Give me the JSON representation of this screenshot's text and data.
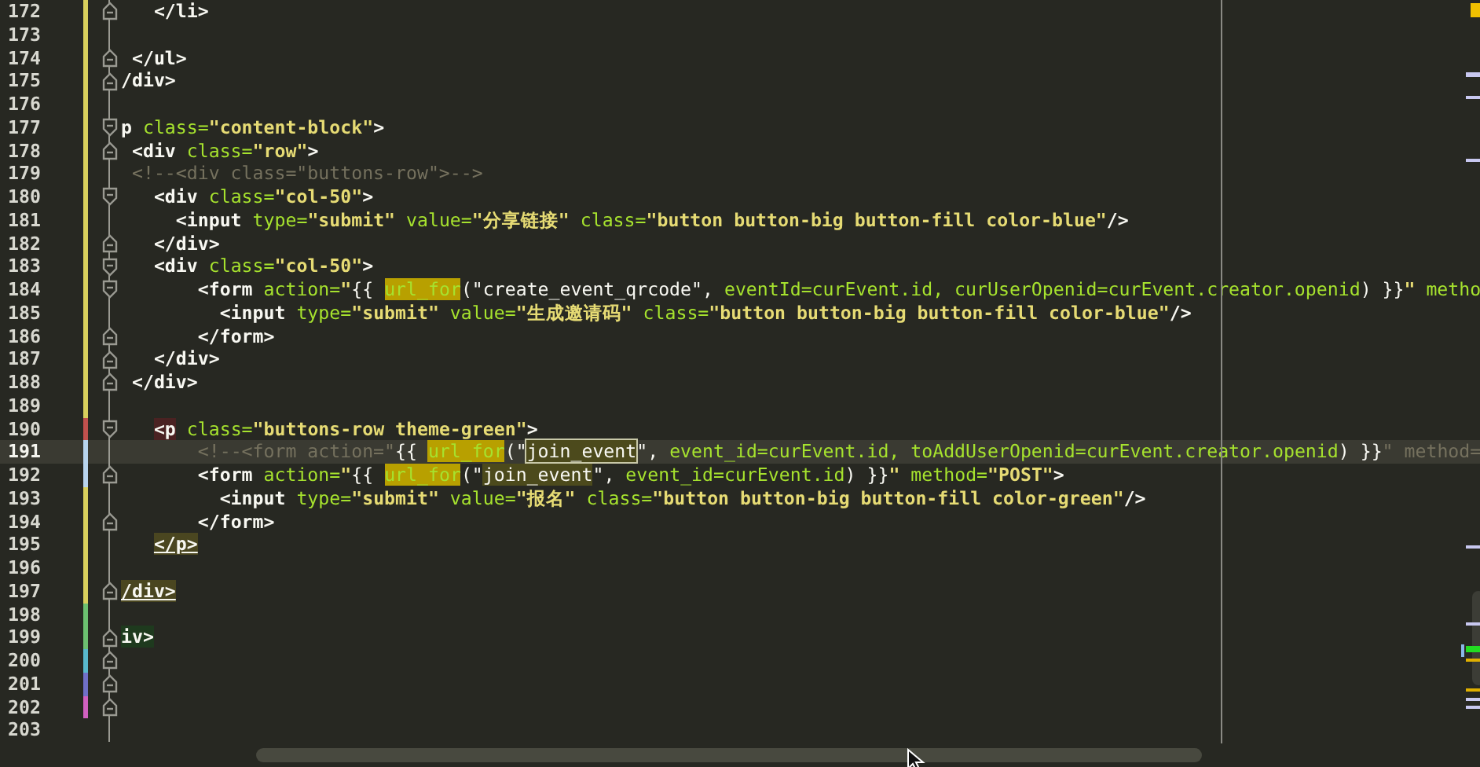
{
  "editor": {
    "lines": [
      {
        "number": "172",
        "color": "#d8cf5c",
        "fold": {
          "kind": "end"
        },
        "current": false,
        "tokens": [
          {
            "kind": "tag",
            "t": "   </li>"
          }
        ]
      },
      {
        "number": "173",
        "color": "#d8cf5c",
        "current": false
      },
      {
        "number": "174",
        "color": "#d8cf5c",
        "fold": {
          "kind": "end"
        },
        "current": false,
        "tokens": [
          {
            "kind": "tag",
            "t": " </ul>"
          }
        ]
      },
      {
        "number": "175",
        "color": "#d8cf5c",
        "fold": {
          "kind": "end"
        },
        "current": false,
        "tokens": [
          {
            "kind": "tag",
            "t": "/div>"
          }
        ]
      },
      {
        "number": "176",
        "color": "#d8cf5c",
        "current": false
      },
      {
        "number": "177",
        "color": "#d8cf5c",
        "fold": {
          "kind": "start"
        },
        "current": false,
        "tokens": [
          {
            "kind": "tag",
            "t": "p"
          },
          {
            "kind": "attr",
            "t": " class="
          },
          {
            "kind": "string",
            "t": "\"content-block\""
          },
          {
            "kind": "tag",
            "t": ">"
          }
        ]
      },
      {
        "number": "178",
        "color": "#d8cf5c",
        "fold": {
          "kind": "end"
        },
        "current": false,
        "tokens": [
          {
            "kind": "tag",
            "t": " <div"
          },
          {
            "kind": "attr",
            "t": " class="
          },
          {
            "kind": "string",
            "t": "\"row\""
          },
          {
            "kind": "tag",
            "t": ">"
          }
        ]
      },
      {
        "number": "179",
        "color": "#d8cf5c",
        "current": false,
        "tokens": [
          {
            "kind": "comment",
            "t": " <!--<div class=\"buttons-row\">-->"
          }
        ]
      },
      {
        "number": "180",
        "color": "#d8cf5c",
        "fold": {
          "kind": "start"
        },
        "current": false,
        "tokens": [
          {
            "kind": "tag",
            "t": "   <div"
          },
          {
            "kind": "attr",
            "t": " class="
          },
          {
            "kind": "string",
            "t": "\"col-50\""
          },
          {
            "kind": "tag",
            "t": ">"
          }
        ]
      },
      {
        "number": "181",
        "color": "#d8cf5c",
        "current": false,
        "tokens": [
          {
            "kind": "tag",
            "t": "     <input"
          },
          {
            "kind": "attr",
            "t": " type="
          },
          {
            "kind": "string",
            "t": "\"submit\""
          },
          {
            "kind": "attr",
            "t": " value="
          },
          {
            "kind": "string",
            "t": "\"分享链接\""
          },
          {
            "kind": "attr",
            "t": " class="
          },
          {
            "kind": "string",
            "t": "\"button button-big button-fill color-blue\""
          },
          {
            "kind": "tag",
            "t": "/>"
          }
        ]
      },
      {
        "number": "182",
        "color": "#d8cf5c",
        "fold": {
          "kind": "end"
        },
        "current": false,
        "tokens": [
          {
            "kind": "tag",
            "t": "   </div>"
          }
        ]
      },
      {
        "number": "183",
        "color": "#d8cf5c",
        "fold": {
          "kind": "start"
        },
        "current": false,
        "tokens": [
          {
            "kind": "tag",
            "t": "   <div"
          },
          {
            "kind": "attr",
            "t": " class="
          },
          {
            "kind": "string",
            "t": "\"col-50\""
          },
          {
            "kind": "tag",
            "t": ">"
          }
        ]
      },
      {
        "number": "184",
        "color": "#d8cf5c",
        "fold": {
          "kind": "start"
        },
        "current": false,
        "tokens": [
          {
            "kind": "tag",
            "t": "       <form"
          },
          {
            "kind": "attr",
            "t": " action="
          },
          {
            "kind": "string",
            "t": "\""
          },
          {
            "kind": "plain",
            "t": "{{ "
          },
          {
            "kind": "expr",
            "t": "url_for",
            "highlight": {
              "kind": "func"
            }
          },
          {
            "kind": "plain",
            "t": "(\"create_event_qrcode\", "
          },
          {
            "kind": "expr",
            "t": "eventId=curEvent.id, curUserOpenid=curEvent.creator.openid"
          },
          {
            "kind": "plain",
            "t": ") }}"
          },
          {
            "kind": "string",
            "t": "\""
          },
          {
            "kind": "attr",
            "t": " metho"
          }
        ]
      },
      {
        "number": "185",
        "color": "#d8cf5c",
        "current": false,
        "tokens": [
          {
            "kind": "tag",
            "t": "         <input"
          },
          {
            "kind": "attr",
            "t": " type="
          },
          {
            "kind": "string",
            "t": "\"submit\""
          },
          {
            "kind": "attr",
            "t": " value="
          },
          {
            "kind": "string",
            "t": "\"生成邀请码\""
          },
          {
            "kind": "attr",
            "t": " class="
          },
          {
            "kind": "string",
            "t": "\"button button-big button-fill color-blue\""
          },
          {
            "kind": "tag",
            "t": "/>"
          }
        ]
      },
      {
        "number": "186",
        "color": "#d8cf5c",
        "fold": {
          "kind": "end"
        },
        "current": false,
        "tokens": [
          {
            "kind": "tag",
            "t": "       </form>"
          }
        ]
      },
      {
        "number": "187",
        "color": "#d8cf5c",
        "fold": {
          "kind": "end"
        },
        "current": false,
        "tokens": [
          {
            "kind": "tag",
            "t": "   </div>"
          }
        ]
      },
      {
        "number": "188",
        "color": "#d8cf5c",
        "fold": {
          "kind": "end"
        },
        "current": false,
        "tokens": [
          {
            "kind": "tag",
            "t": " </div>"
          }
        ]
      },
      {
        "number": "189",
        "color": "#d8cf5c",
        "current": false
      },
      {
        "number": "190",
        "color": "#c0504d",
        "fold": {
          "kind": "start"
        },
        "current": false,
        "tokens": [
          {
            "kind": "tag",
            "t": "   <p",
            "highlight": {
              "kind": "unmatched"
            }
          },
          {
            "kind": "attr",
            "t": " class="
          },
          {
            "kind": "string",
            "t": "\"buttons-row theme-green\""
          },
          {
            "kind": "tag",
            "t": ">"
          }
        ]
      },
      {
        "number": "191",
        "color": "#b8d4ee",
        "current": true,
        "tokens": [
          {
            "kind": "comment",
            "t": "       <!--<form action=\""
          },
          {
            "kind": "plain",
            "t": "{{ "
          },
          {
            "kind": "expr",
            "t": "url_for",
            "highlight": {
              "kind": "func"
            }
          },
          {
            "kind": "plain",
            "t": "(\""
          },
          {
            "kind": "plain",
            "t": "join_event",
            "highlight": {
              "kind": "selection"
            }
          },
          {
            "kind": "plain",
            "t": "\", "
          },
          {
            "kind": "expr",
            "t": "event_id=curEvent.id, toAddUserOpenid=curEvent.creator.openid"
          },
          {
            "kind": "plain",
            "t": ") }}"
          },
          {
            "kind": "comment",
            "t": "\" method="
          }
        ]
      },
      {
        "number": "192",
        "color": "#b8d4ee",
        "fold": {
          "kind": "end"
        },
        "current": false,
        "tokens": [
          {
            "kind": "tag",
            "t": "       <form"
          },
          {
            "kind": "attr",
            "t": " action="
          },
          {
            "kind": "string",
            "t": "\""
          },
          {
            "kind": "plain",
            "t": "{{ "
          },
          {
            "kind": "expr",
            "t": "url_for",
            "highlight": {
              "kind": "func"
            }
          },
          {
            "kind": "plain",
            "t": "(\""
          },
          {
            "kind": "plain",
            "t": "join_event",
            "highlight": {
              "kind": "word"
            }
          },
          {
            "kind": "plain",
            "t": "\", "
          },
          {
            "kind": "expr",
            "t": "event_id=curEvent.id"
          },
          {
            "kind": "plain",
            "t": ") }}"
          },
          {
            "kind": "string",
            "t": "\""
          },
          {
            "kind": "attr",
            "t": " method="
          },
          {
            "kind": "string",
            "t": "\"POST\""
          },
          {
            "kind": "tag",
            "t": ">"
          }
        ]
      },
      {
        "number": "193",
        "color": "#d8cf5c",
        "current": false,
        "tokens": [
          {
            "kind": "tag",
            "t": "         <input"
          },
          {
            "kind": "attr",
            "t": " type="
          },
          {
            "kind": "string",
            "t": "\"submit\""
          },
          {
            "kind": "attr",
            "t": " value="
          },
          {
            "kind": "string",
            "t": "\"报名\""
          },
          {
            "kind": "attr",
            "t": " class="
          },
          {
            "kind": "string",
            "t": "\"button button-big button-fill color-green\""
          },
          {
            "kind": "tag",
            "t": "/>"
          }
        ]
      },
      {
        "number": "194",
        "color": "#d8cf5c",
        "fold": {
          "kind": "end"
        },
        "current": false,
        "tokens": [
          {
            "kind": "tag",
            "t": "       </form>"
          }
        ]
      },
      {
        "number": "195",
        "color": "#d8cf5c",
        "current": false,
        "tokens": [
          {
            "kind": "tag",
            "t": "   </p>",
            "highlight": {
              "kind": "bracket"
            }
          }
        ]
      },
      {
        "number": "196",
        "color": "#d8cf5c",
        "current": false
      },
      {
        "number": "197",
        "color": "#d8cf5c",
        "fold": {
          "kind": "end"
        },
        "current": false,
        "tokens": [
          {
            "kind": "tag",
            "t": "/div>",
            "highlight": {
              "kind": "bracket"
            }
          }
        ]
      },
      {
        "number": "198",
        "color": "#6cc070",
        "current": false
      },
      {
        "number": "199",
        "color": "#6cc070",
        "fold": {
          "kind": "end"
        },
        "current": false,
        "tokens": [
          {
            "kind": "tag",
            "t": "iv>",
            "highlight": {
              "kind": "scope"
            }
          }
        ]
      },
      {
        "number": "200",
        "color": "#58b8cc",
        "fold": {
          "kind": "end"
        },
        "current": false
      },
      {
        "number": "201",
        "color": "#7070c8",
        "fold": {
          "kind": "end"
        },
        "current": false
      },
      {
        "number": "202",
        "color": "#d060c0",
        "fold": {
          "kind": "end"
        },
        "current": false
      },
      {
        "number": "203",
        "current": false
      }
    ]
  }
}
